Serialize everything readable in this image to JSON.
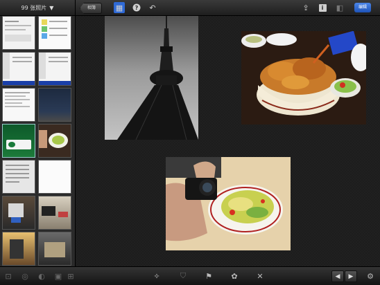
{
  "topbar": {
    "photo_count_label": "99 张照片",
    "caret": "▼",
    "back_label": "相簿",
    "edit_label": "编辑",
    "icons": {
      "grid": "▦",
      "help": "?",
      "undo": "↶",
      "share": "⇪",
      "info": "i",
      "compare": "◧"
    }
  },
  "bottombar": {
    "icons": {
      "auto_enhance": "✧",
      "crop": "⛉",
      "flag": "⚑",
      "favorite": "✿",
      "delete": "✕",
      "prev": "◀",
      "next": "▶",
      "settings": "⚙"
    }
  },
  "thumbnails": [
    {
      "kind": "screenshot"
    },
    {
      "kind": "chart"
    },
    {
      "kind": "screenshot-blue"
    },
    {
      "kind": "screenshot-blue"
    },
    {
      "kind": "document"
    },
    {
      "kind": "night-sky"
    },
    {
      "kind": "green-logo"
    },
    {
      "kind": "salad"
    },
    {
      "kind": "document-gray"
    },
    {
      "kind": "white"
    },
    {
      "kind": "photo-device"
    },
    {
      "kind": "photo-desk"
    },
    {
      "kind": "photo-warm"
    },
    {
      "kind": "photo-dark"
    }
  ]
}
